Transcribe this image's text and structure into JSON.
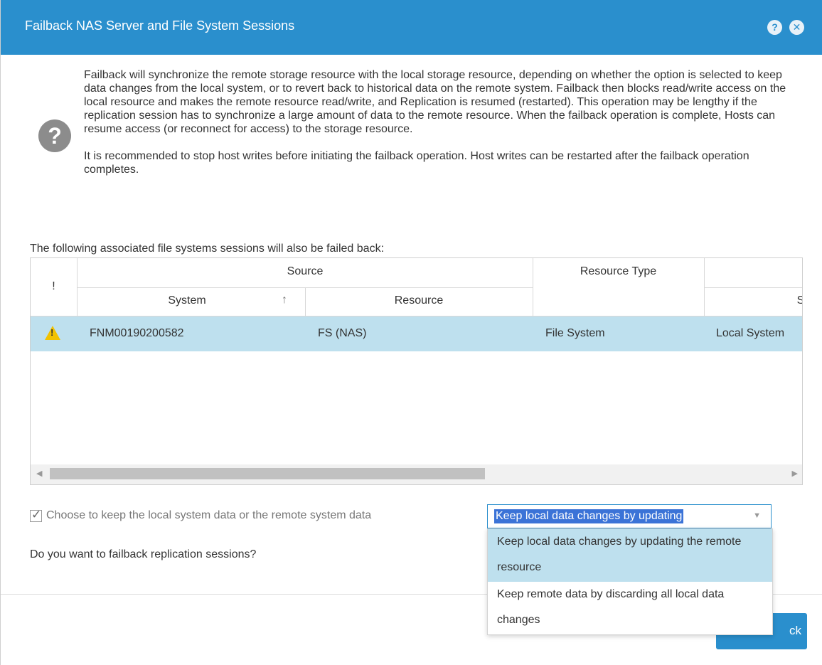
{
  "dialog": {
    "title": "Failback NAS Server and File System Sessions",
    "help": "?",
    "close": "✕"
  },
  "description": {
    "para1": "Failback will synchronize the remote storage resource with the local storage resource, depending on whether the option is selected to keep data changes from the local system, or to revert back to historical data on the remote system. Failback then blocks read/write access on the local resource and makes the remote resource read/write, and Replication is resumed (restarted). This operation may be lengthy if the replication session has to synchronize a large amount of data to the remote resource. When the failback operation is complete, Hosts can resume access (or reconnect for access) to the storage resource.",
    "para2": "It is recommended to stop host writes before initiating the failback operation. Host writes can be restarted after the failback operation completes."
  },
  "assoc_label": "The following associated file systems sessions will also be failed back:",
  "table": {
    "headers": {
      "alert": "!",
      "source": "Source",
      "system": "System",
      "sort_icon": "↑",
      "resource": "Resource",
      "resource_type": "Resource Type",
      "partial": "S"
    },
    "rows": [
      {
        "system": "FNM00190200582",
        "resource": "FS (NAS)",
        "resource_type": "File System",
        "destination": "Local System"
      }
    ]
  },
  "option": {
    "checkbox_label": "Choose to keep the local system data or the remote system data",
    "checked": true,
    "selected_value": "Keep local data changes by updating",
    "options": [
      "Keep local data changes by updating the remote resource",
      "Keep remote data by discarding all local data changes"
    ]
  },
  "question": "Do you want to failback replication sessions?",
  "buttons": {
    "failback_visible": "ck"
  },
  "colors": {
    "accent": "#2a8fcd",
    "row_selected": "#bee0ee",
    "warning": "#f2c200"
  }
}
